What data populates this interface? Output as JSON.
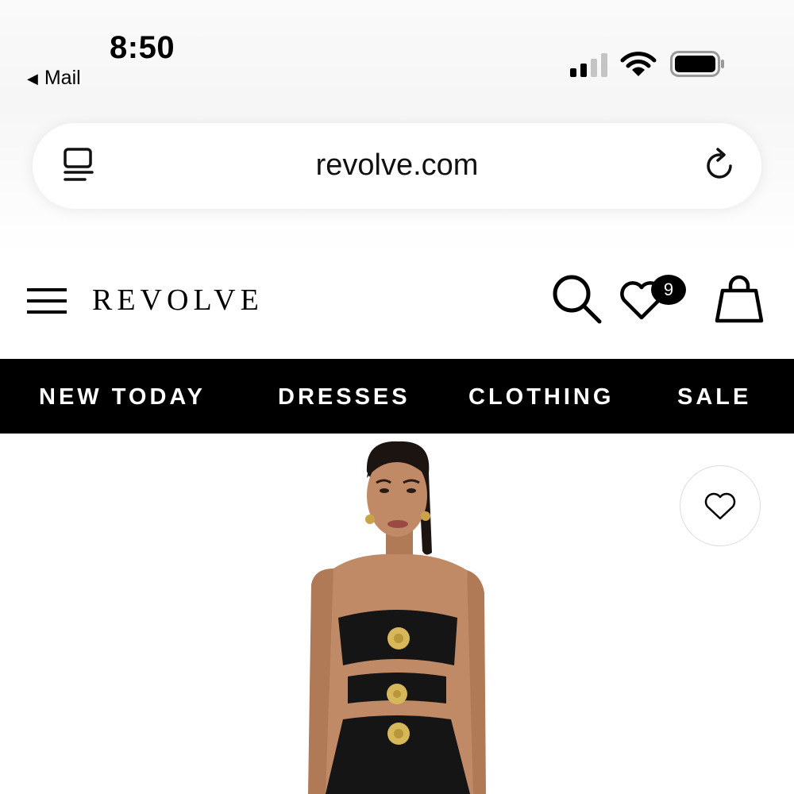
{
  "status_bar": {
    "time": "8:50",
    "back_label": "Mail",
    "back_icon": "back-triangle-icon",
    "signal_icon": "cellular-signal-icon",
    "wifi_icon": "wifi-icon",
    "battery_icon": "battery-icon"
  },
  "browser": {
    "url": "revolve.com",
    "reader_icon": "page-menu-icon",
    "reload_icon": "reload-icon"
  },
  "site_header": {
    "logo": "REVOLVE",
    "menu_icon": "hamburger-menu-icon",
    "search_icon": "search-icon",
    "wishlist_icon": "heart-icon",
    "wishlist_count": "9",
    "bag_icon": "shopping-bag-icon"
  },
  "nav": {
    "items": [
      {
        "label": "NEW TODAY"
      },
      {
        "label": "DRESSES"
      },
      {
        "label": "CLOTHING"
      },
      {
        "label": "SALE"
      }
    ]
  },
  "product": {
    "favorite_icon": "heart-outline-icon"
  },
  "colors": {
    "nav_background": "#000000",
    "nav_text": "#ffffff",
    "page_background": "#ffffff"
  }
}
